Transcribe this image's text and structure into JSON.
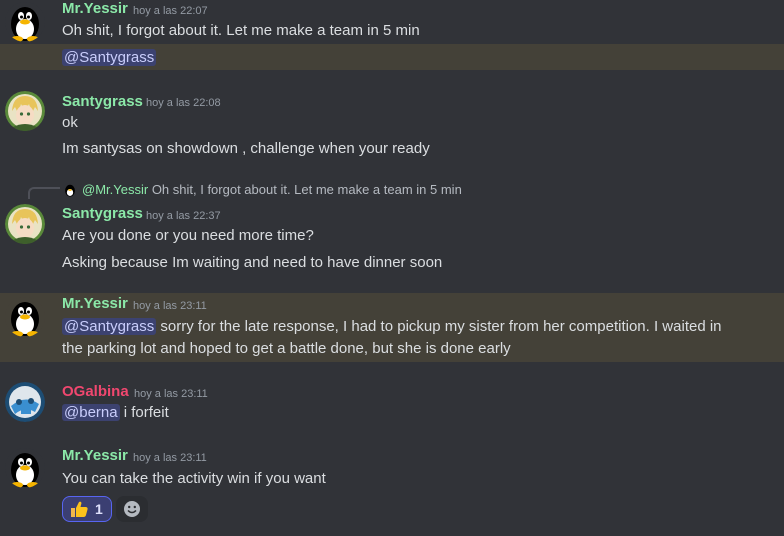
{
  "messages": [
    {
      "username": "Mr.Yessir",
      "timestamp": "hoy a las 22:07",
      "lines": [
        "Oh shit, I forgot about it. Let me make a team in 5 min"
      ],
      "mention_line": "@Santygrass"
    },
    {
      "username": "Santygrass",
      "timestamp": "hoy a las 22:08",
      "lines": [
        "ok",
        "Im santysas on showdown , challenge when your ready"
      ]
    },
    {
      "reply": {
        "mention": "@Mr.Yessir",
        "text": "Oh shit, I forgot about it. Let me make a team in 5 min"
      },
      "username": "Santygrass",
      "timestamp": "hoy a las 22:37",
      "lines": [
        "Are you done or you need more time?",
        "Asking because Im waiting and need to have dinner soon"
      ]
    },
    {
      "username": "Mr.Yessir",
      "timestamp": "hoy a las 23:11",
      "mention": "@Santygrass",
      "line1_rest": " sorry for the late response, I had to pickup my sister from her competition. I waited in",
      "line2": "the parking lot and hoped to get a battle done, but she is done early"
    },
    {
      "username": "OGalbina",
      "timestamp": "hoy a las 23:11",
      "mention": "@berna",
      "rest": " i forfeit"
    },
    {
      "username": "Mr.Yessir",
      "timestamp": "hoy a las 23:11",
      "lines": [
        "You can take the activity win if you want"
      ],
      "reaction": {
        "emoji": "thumbs-up-icon",
        "count": "1"
      }
    }
  ],
  "colors": {
    "background": "#313338",
    "highlight": "#444138",
    "username_green": "#8be8a8",
    "username_pink": "#f0476f",
    "mention_bg": "#3c4270",
    "mention_text": "#c9cdfb",
    "reaction_bg": "#3b3f72",
    "reaction_border": "#5865f2"
  }
}
